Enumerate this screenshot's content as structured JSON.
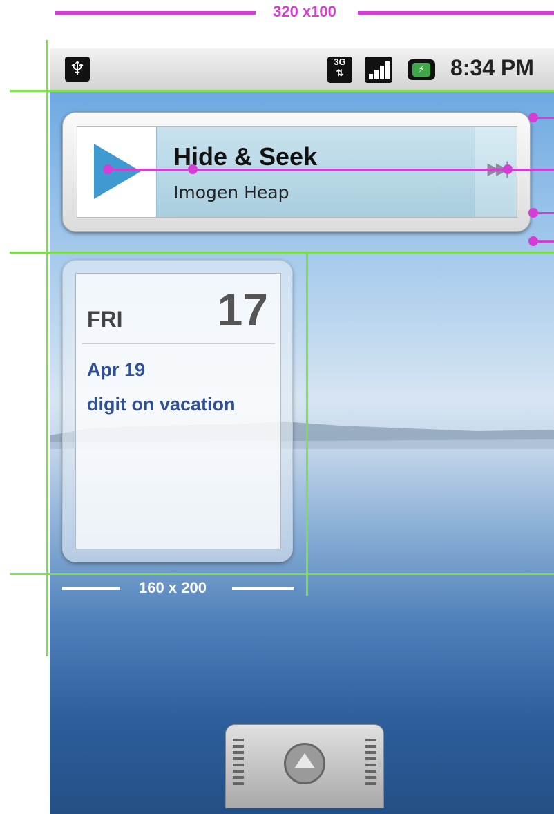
{
  "annotations": {
    "top_dimension": "320 x100",
    "calendar_dimension": "160 x 200"
  },
  "status_bar": {
    "usb_icon": "usb-icon",
    "network_label": "3G",
    "time": "8:34 PM"
  },
  "music_widget": {
    "title": "Hide & Seek",
    "artist": "Imogen Heap"
  },
  "calendar_widget": {
    "day": "FRI",
    "date": "17",
    "event_date": "Apr 19",
    "event_title": "digit on vacation"
  },
  "colors": {
    "annotation_magenta": "#d63cd6",
    "guide_green": "#7be04a",
    "calendar_text_blue": "#2f4f96"
  }
}
